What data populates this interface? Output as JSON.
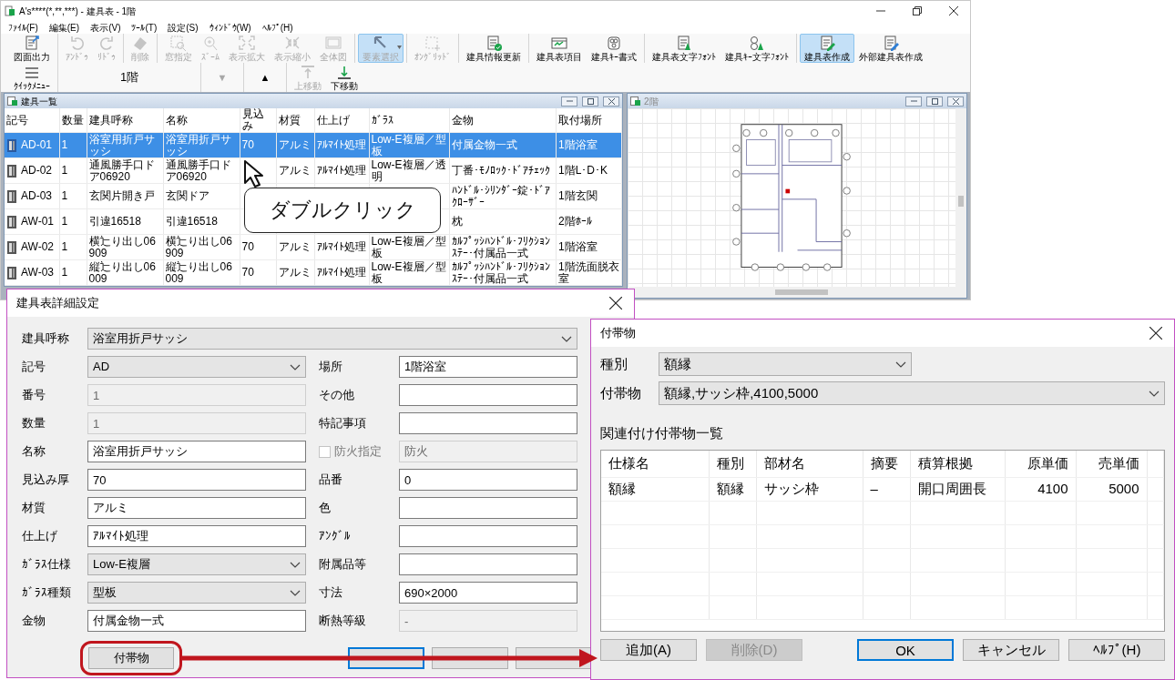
{
  "window": {
    "title": "A's****(*,**,***) - 建具表 - 1階"
  },
  "menu": [
    "ﾌｧｲﾙ(F)",
    "編集(E)",
    "表示(V)",
    "ﾂｰﾙ(T)",
    "設定(S)",
    "ｳｨﾝﾄﾞｳ(W)",
    "ﾍﾙﾌﾟ(H)"
  ],
  "toolbar_groups": [
    [
      {
        "label": "図面出力",
        "kind": "export",
        "disabled": false,
        "selected": false
      }
    ],
    [
      {
        "label": "ｱﾝﾄﾞｩ",
        "kind": "undo",
        "disabled": true,
        "selected": false
      },
      {
        "label": "ﾘﾄﾞｩ",
        "kind": "redo",
        "disabled": true,
        "selected": false
      }
    ],
    [
      {
        "label": "削除",
        "kind": "eraser",
        "disabled": true,
        "selected": false
      }
    ],
    [
      {
        "label": "窓指定",
        "kind": "zoomwin",
        "disabled": true,
        "selected": false
      },
      {
        "label": "ｽﾞｰﾑ",
        "kind": "zoom",
        "disabled": true,
        "selected": false
      },
      {
        "label": "表示拡大",
        "kind": "expand",
        "disabled": true,
        "selected": false
      },
      {
        "label": "表示縮小",
        "kind": "shrink",
        "disabled": true,
        "selected": false
      },
      {
        "label": "全体図",
        "kind": "whole",
        "disabled": true,
        "selected": false
      }
    ],
    [
      {
        "label": "要素選択",
        "kind": "pointer",
        "disabled": true,
        "selected": true,
        "dropdown": true
      }
    ],
    [
      {
        "label": "ｵﾝｸﾞﾘｯﾄﾞ",
        "kind": "grid",
        "disabled": true,
        "selected": false
      }
    ],
    [
      {
        "label": "建具情報更新",
        "kind": "doccheck",
        "disabled": false,
        "selected": false
      }
    ],
    [
      {
        "label": "建具表項目",
        "kind": "table",
        "disabled": false,
        "selected": false
      },
      {
        "label": "建具ｷｰ書式",
        "kind": "key",
        "disabled": false,
        "selected": false
      }
    ],
    [
      {
        "label": "建具表文字ﾌｫﾝﾄ",
        "kind": "fontdoc",
        "disabled": false,
        "selected": false
      },
      {
        "label": "建具ｷｰ文字ﾌｫﾝﾄ",
        "kind": "fontkey",
        "disabled": false,
        "selected": false
      }
    ],
    [
      {
        "label": "建具表作成",
        "kind": "pendoc",
        "disabled": false,
        "selected": true
      },
      {
        "label": "外部建具表作成",
        "kind": "pendoc2",
        "disabled": false,
        "selected": false
      }
    ]
  ],
  "toolbar_row2": [
    [
      {
        "kind": "menu",
        "label": "ｸｲｯｸﾒﾆｭｰ",
        "disabled": false
      }
    ],
    [
      {
        "kind": "floor",
        "label": "1階",
        "disabled": false
      }
    ],
    [
      {
        "kind": "glyph",
        "label": "▼",
        "disabled": true
      }
    ],
    [
      {
        "kind": "glyph",
        "label": "▲",
        "disabled": false
      }
    ],
    [
      {
        "kind": "up",
        "label": "上移動",
        "disabled": true
      },
      {
        "kind": "down",
        "label": "下移動",
        "disabled": false
      }
    ]
  ],
  "list_window": {
    "title": "建具一覧",
    "columns": [
      "記号",
      "数量",
      "建具呼称",
      "名称",
      "見込み",
      "材質",
      "仕上げ",
      "ｶﾞﾗｽ",
      "金物",
      "取付場所"
    ],
    "rows": [
      {
        "selected": true,
        "cells": [
          "AD-01",
          "1",
          "浴室用折戸サッシ",
          "浴室用折戸サッシ",
          "70",
          "アルミ",
          "ｱﾙﾏｲﾄ処理",
          "Low-E複層／型板",
          "付属金物一式",
          "1階浴室"
        ]
      },
      {
        "selected": false,
        "cells": [
          "AD-02",
          "1",
          "通風勝手口ドア06920",
          "通風勝手口ドア06920",
          null,
          "アルミ",
          "ｱﾙﾏｲﾄ処理",
          "Low-E複層／透明",
          "丁番･ﾓﾉﾛｯｸ･ﾄﾞｱﾁｪｯｸ",
          "1階L･D･K"
        ]
      },
      {
        "selected": false,
        "cells": [
          "AD-03",
          "1",
          "玄関片開き戸",
          "玄関ドア",
          null,
          null,
          null,
          null,
          "ﾊﾝﾄﾞﾙ･ｼﾘﾝﾀﾞｰ錠･ﾄﾞｱｸﾛｰｻﾞｰ",
          "1階玄関"
        ]
      },
      {
        "selected": false,
        "cells": [
          "AW-01",
          "1",
          "引違16518",
          "引違16518",
          null,
          null,
          null,
          null,
          "枕",
          "2階ﾎｰﾙ"
        ]
      },
      {
        "selected": false,
        "cells": [
          "AW-02",
          "1",
          "横辷り出し06909",
          "横辷り出し06909",
          "70",
          "アルミ",
          "ｱﾙﾏｲﾄ処理",
          "Low-E複層／型板",
          "ｶﾙﾌﾟｯｼﾊﾝﾄﾞﾙ･ﾌﾘｸｼｮﾝｽﾃｰ･付属品一式",
          "1階浴室"
        ]
      },
      {
        "selected": false,
        "cells": [
          "AW-03",
          "1",
          "縦辷り出し06009",
          "縦辷り出し06009",
          "70",
          "アルミ",
          "ｱﾙﾏｲﾄ処理",
          "Low-E複層／型板",
          "ｶﾙﾌﾟｯｼﾊﾝﾄﾞﾙ･ﾌﾘｸｼｮﾝｽﾃｰ･付属品一式",
          "1階洗面脱衣室"
        ]
      }
    ]
  },
  "callout": {
    "text": "ダブルクリック"
  },
  "plan_window": {
    "title": "2階"
  },
  "detail_dialog": {
    "title": "建具表詳細設定",
    "top_field": {
      "label": "建具呼称",
      "kind": "select",
      "value": "浴室用折戸サッシ",
      "disabled": false
    },
    "left_fields": [
      {
        "label": "記号",
        "kind": "select",
        "value": "AD",
        "disabled": false
      },
      {
        "label": "番号",
        "kind": "text",
        "value": "1",
        "disabled": true
      },
      {
        "label": "数量",
        "kind": "text",
        "value": "1",
        "disabled": true
      },
      {
        "label": "名称",
        "kind": "text",
        "value": "浴室用折戸サッシ",
        "disabled": false
      },
      {
        "label": "見込み厚",
        "kind": "text",
        "value": "70",
        "disabled": false
      },
      {
        "label": "材質",
        "kind": "text",
        "value": "アルミ",
        "disabled": false
      },
      {
        "label": "仕上げ",
        "kind": "text",
        "value": "ｱﾙﾏｲﾄ処理",
        "disabled": false
      },
      {
        "label": "ｶﾞﾗｽ仕様",
        "kind": "select",
        "value": "Low-E複層",
        "disabled": false
      },
      {
        "label": "ｶﾞﾗｽ種類",
        "kind": "select",
        "value": "型板",
        "disabled": false
      },
      {
        "label": "金物",
        "kind": "text",
        "value": "付属金物一式",
        "disabled": false
      }
    ],
    "right_fields": [
      {
        "label": "場所",
        "kind": "text",
        "value": "1階浴室",
        "disabled": false
      },
      {
        "label": "その他",
        "kind": "text",
        "disabled": false
      },
      {
        "label": "特記事項",
        "kind": "text",
        "disabled": false
      },
      {
        "label": "防火指定",
        "kind": "checkbox",
        "checked": false,
        "value": "防火",
        "disabled": true
      },
      {
        "label": "品番",
        "kind": "text",
        "value": "0",
        "disabled": false
      },
      {
        "label": "色",
        "kind": "text",
        "disabled": false
      },
      {
        "label": "ｱﾝｸﾞﾙ",
        "kind": "text",
        "disabled": false
      },
      {
        "label": "附属品等",
        "kind": "text",
        "disabled": false
      },
      {
        "label": "寸法",
        "kind": "text",
        "value": "690×2000",
        "disabled": false
      },
      {
        "label": "断熱等級",
        "kind": "text",
        "value": "-",
        "disabled": true
      }
    ],
    "accessory_button": {
      "label": "付帯物",
      "highlighted": true
    },
    "footer_buttons": [
      {
        "default": true
      },
      {
        "default": false
      },
      {
        "default": false
      }
    ]
  },
  "accessory_dialog": {
    "title": "付帯物",
    "type_field": {
      "label": "種別",
      "value": "額縁"
    },
    "item_field": {
      "label": "付帯物",
      "value": "額縁,サッシ枠,4100,5000"
    },
    "list_title": "関連付け付帯物一覧",
    "columns": [
      {
        "label": "仕様名",
        "kind": "text"
      },
      {
        "label": "種別",
        "kind": "text"
      },
      {
        "label": "部材名",
        "kind": "text"
      },
      {
        "label": "摘要",
        "kind": "text"
      },
      {
        "label": "積算根拠",
        "kind": "text"
      },
      {
        "label": "原単価",
        "kind": "number"
      },
      {
        "label": "売単価",
        "kind": "number"
      }
    ],
    "rows": [
      [
        "額縁",
        "額縁",
        "サッシ枠",
        "–",
        "開口周囲長",
        "4100",
        "5000"
      ]
    ],
    "left_buttons": [
      {
        "label": "追加(A)",
        "disabled": false,
        "default": false
      },
      {
        "label": "削除(D)",
        "disabled": true,
        "default": false
      }
    ],
    "right_buttons": [
      {
        "label": "OK",
        "disabled": false,
        "default": true
      },
      {
        "label": "キャンセル",
        "disabled": false,
        "default": false
      },
      {
        "label": "ﾍﾙﾌﾟ(H)",
        "disabled": false,
        "default": false
      }
    ]
  }
}
